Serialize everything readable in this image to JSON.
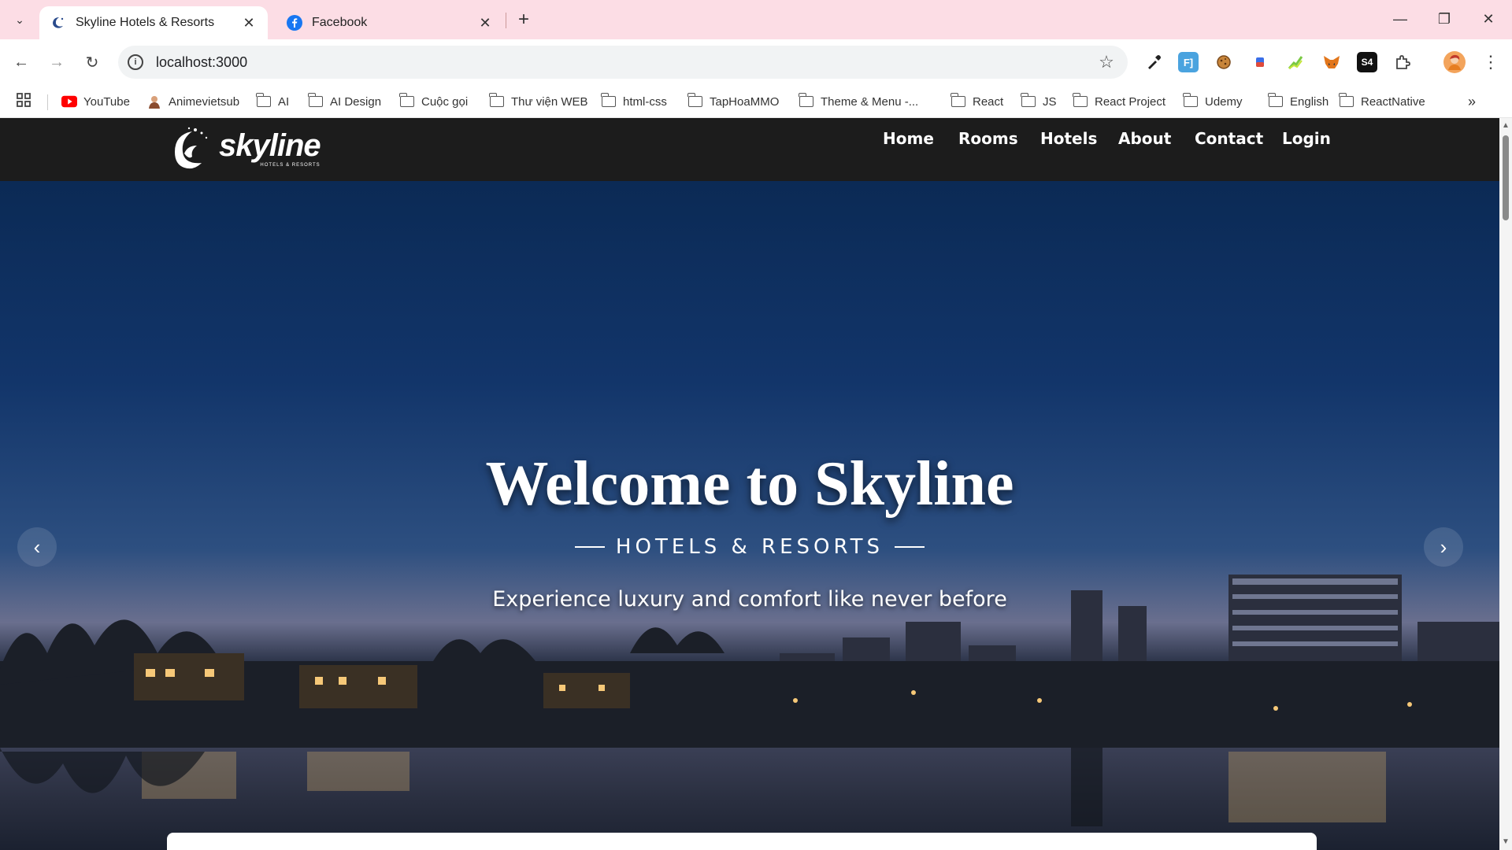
{
  "browser": {
    "tabs": [
      {
        "title": "Skyline Hotels & Resorts",
        "active": true
      },
      {
        "title": "Facebook",
        "active": false
      }
    ],
    "url": "localhost:3000",
    "bookmarks": [
      "YouTube",
      "Animevietsub",
      "AI",
      "AI Design",
      "Cuộc gọi",
      "Thư viện WEB",
      "html-css",
      "TapHoaMMO",
      "Theme & Menu -...",
      "React",
      "JS",
      "React Project",
      "Udemy",
      "English",
      "ReactNative"
    ],
    "extensions": [
      "F]",
      "S4"
    ]
  },
  "site": {
    "logo_text": "skyline",
    "logo_sub": "HOTELS & RESORTS",
    "nav": [
      "Home",
      "Rooms",
      "Hotels",
      "About",
      "Contact",
      "Login"
    ]
  },
  "hero": {
    "title": "Welcome to Skyline",
    "subtitle": "HOTELS & RESORTS",
    "tagline": "Experience luxury and comfort like never before",
    "prev_glyph": "‹",
    "next_glyph": "›"
  }
}
